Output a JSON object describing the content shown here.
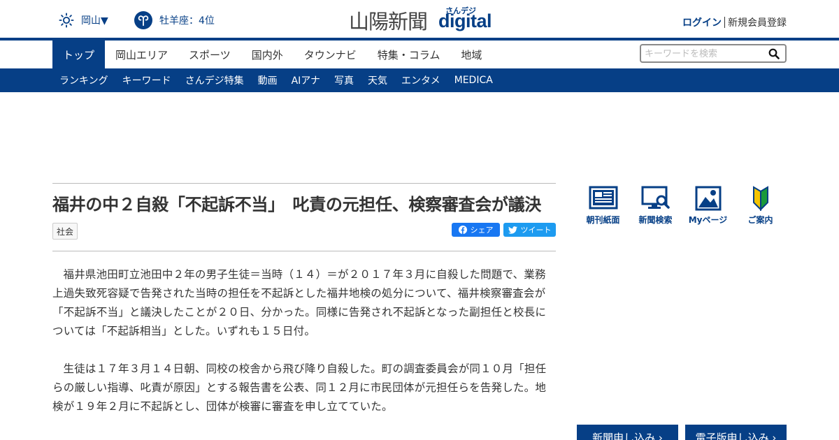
{
  "header": {
    "weather_region": "岡山▼",
    "horoscope": "牡羊座：4位",
    "logo_jp": "山陽新聞",
    "logo_sandeji": "さんデジ",
    "logo_digital": "digital",
    "login": "ログイン",
    "register": "新規会員登録"
  },
  "nav": {
    "items": [
      {
        "label": "トップ"
      },
      {
        "label": "岡山エリア"
      },
      {
        "label": "スポーツ"
      },
      {
        "label": "国内外"
      },
      {
        "label": "タウンナビ"
      },
      {
        "label": "特集・コラム"
      },
      {
        "label": "地域"
      }
    ],
    "active_index": 0
  },
  "search": {
    "placeholder": "キーワードを検索"
  },
  "subnav": {
    "items": [
      {
        "label": "ランキング"
      },
      {
        "label": "キーワード"
      },
      {
        "label": "さんデジ特集"
      },
      {
        "label": "動画"
      },
      {
        "label": "AIアナ"
      },
      {
        "label": "写真"
      },
      {
        "label": "天気"
      },
      {
        "label": "エンタメ"
      },
      {
        "label": "MEDICA"
      }
    ]
  },
  "article": {
    "headline": "福井の中２自殺「不起訴不当」　叱責の元担任、検察審査会が議決",
    "category": "社会",
    "share_facebook": "シェア",
    "share_twitter": "ツイート",
    "paragraphs": [
      "福井県池田町立池田中２年の男子生徒＝当時（１４）＝が２０１７年３月に自殺した問題で、業務上過失致死容疑で告発された当時の担任を不起訴とした福井地検の処分について、福井検察審査会が「不起訴不当」と議決したことが２０日、分かった。同様に告発され不起訴となった副担任と校長については「不起訴相当」とした。いずれも１５日付。",
      "生徒は１７年３月１４日朝、同校の校舎から飛び降り自殺した。町の調査委員会が同１０月「担任らの厳しい指導、叱責が原因」とする報告書を公表、同１２月に市民団体が元担任らを告発した。地検が１９年２月に不起訴とし、団体が検審に審査を申し立てていた。"
    ]
  },
  "sidebar": {
    "icons": [
      {
        "label": "朝刊紙面",
        "icon": "newspaper-icon"
      },
      {
        "label": "新聞検索",
        "icon": "monitor-search-icon"
      },
      {
        "label": "Myページ",
        "icon": "user-page-icon"
      },
      {
        "label": "ご案内",
        "icon": "beginner-mark-icon"
      }
    ],
    "cta_newspaper": "新聞申し込み ›",
    "cta_digital": "電子版申し込み ›"
  },
  "colors": {
    "brand": "#063f86",
    "facebook": "#1877f2",
    "twitter": "#1d9bf0"
  }
}
